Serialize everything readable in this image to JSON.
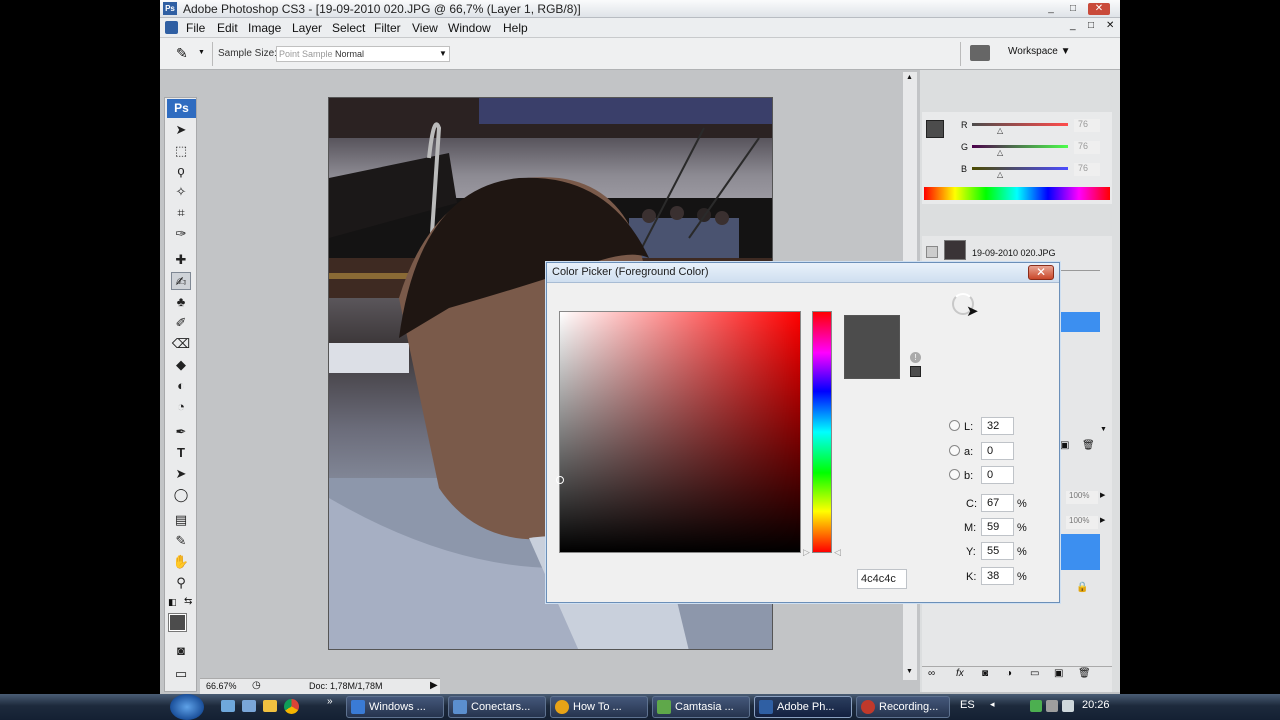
{
  "app": {
    "ps_badge": "Ps",
    "title": "Adobe Photoshop CS3 - [19-09-2010 020.JPG @ 66,7% (Layer 1, RGB/8)]",
    "window_buttons": [
      "_",
      "□",
      "✕"
    ],
    "doc_buttons": [
      "_",
      "□",
      "✕"
    ]
  },
  "menu": [
    "File",
    "Edit",
    "Image",
    "Layer",
    "Select",
    "Filter",
    "View",
    "Window",
    "Help"
  ],
  "options": {
    "sample_size_label": "Sample Size:",
    "sample_size_value": "Point Sample",
    "sample_value_2": "Normal",
    "workspace_label": "Workspace ▼"
  },
  "toolbox": {
    "badge": "Ps"
  },
  "status": {
    "zoom": "66.67%",
    "doc": "Doc: 1,78M/1,78M"
  },
  "color_panel": {
    "r_label": "R",
    "g_label": "G",
    "b_label": "B",
    "r_value": "76",
    "g_value": "76",
    "b_value": "76",
    "fg_color": "#4c4c4c"
  },
  "layers_panel": {
    "layer_name": "19-09-2010 020.JPG",
    "opacity": "100%",
    "fill": "100%"
  },
  "color_picker": {
    "title": "Color Picker (Foreground Color)",
    "current_color": "#4c4c4c",
    "fields": {
      "L": {
        "label": "L:",
        "value": "32"
      },
      "a": {
        "label": "a:",
        "value": "0"
      },
      "b": {
        "label": "b:",
        "value": "0"
      },
      "C": {
        "label": "C:",
        "value": "67",
        "unit": "%"
      },
      "M": {
        "label": "M:",
        "value": "59",
        "unit": "%"
      },
      "Y": {
        "label": "Y:",
        "value": "55",
        "unit": "%"
      },
      "K": {
        "label": "K:",
        "value": "38",
        "unit": "%"
      }
    },
    "hex": "4c4c4c"
  },
  "taskbar": {
    "items": [
      {
        "label": "Windows ...",
        "color": "#3a7bd5"
      },
      {
        "label": "Conectars...",
        "color": "#5b8fcf"
      },
      {
        "label": "How To ...",
        "color": "#e8a317"
      },
      {
        "label": "Camtasia ...",
        "color": "#5fa84a"
      },
      {
        "label": "Adobe Ph...",
        "color": "#2f5fa3"
      },
      {
        "label": "Recording...",
        "color": "#c0392b"
      }
    ],
    "lang": "ES",
    "clock": "20:26"
  }
}
